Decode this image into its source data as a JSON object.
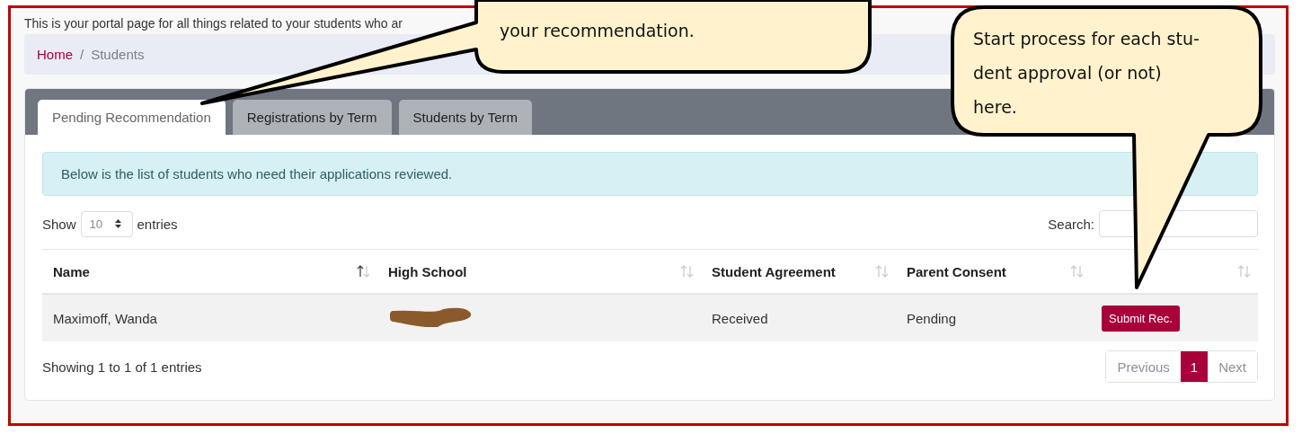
{
  "intro": "This is your portal page for all things related to your students who ar",
  "breadcrumb": [
    {
      "label": "Home",
      "link": true
    },
    {
      "separator": "/",
      "label": "Students",
      "link": false
    }
  ],
  "tabs": [
    {
      "label": "Pending Recommendation",
      "selected": true
    },
    {
      "label": "Registrations by Term",
      "selected": false
    },
    {
      "label": "Students by Term",
      "selected": false
    }
  ],
  "alert": "Below is the list of students who need their applications reviewed.",
  "length_menu": {
    "before": "Show",
    "value": "10",
    "after": "entries"
  },
  "search": {
    "label": "Search:"
  },
  "table": {
    "columns": [
      {
        "label": "Name",
        "sorted": true
      },
      {
        "label": "High School",
        "sorted": false
      },
      {
        "label": "Student Agreement",
        "sorted": false
      },
      {
        "label": "Parent Consent",
        "sorted": false
      },
      {
        "sorted": false
      }
    ],
    "rows": [
      {
        "cells": [
          {
            "kind": "text",
            "text": "Maximoff, Wanda"
          },
          {
            "kind": "redacted"
          },
          {
            "kind": "text",
            "text": "Received"
          },
          {
            "kind": "text",
            "text": "Pending"
          },
          {
            "kind": "button",
            "text": "Submit Rec."
          }
        ]
      }
    ]
  },
  "info": "Showing 1 to 1 of 1 entries",
  "pagination": [
    {
      "label": "Previous",
      "selected": false,
      "disabled": true
    },
    {
      "label": "1",
      "selected": true,
      "disabled": false
    },
    {
      "label": "Next",
      "selected": false,
      "disabled": true
    }
  ],
  "callouts": [
    {
      "lines": [
        "your recommendation."
      ]
    },
    {
      "lines": [
        "Start process for each stu-",
        "dent approval (or not)",
        "here."
      ]
    }
  ]
}
